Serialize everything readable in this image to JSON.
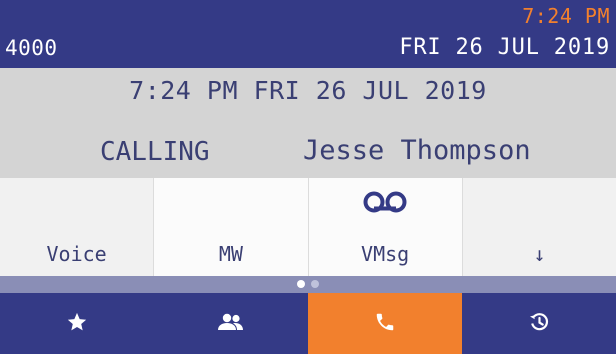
{
  "status_bar": {
    "extension": "4000",
    "time": "7:24 PM",
    "date": "FRI 26 JUL 2019"
  },
  "call_info": {
    "datetime": "7:24 PM FRI 26 JUL 2019",
    "status": "CALLING",
    "caller": "Jesse Thompson"
  },
  "softkeys": [
    {
      "label": "Voice"
    },
    {
      "label": "MW"
    },
    {
      "label": "VMsg",
      "icon": "voicemail-icon"
    },
    {
      "label": "↓"
    }
  ],
  "pager": {
    "pages": 2,
    "current": 1
  },
  "nav": [
    {
      "icon": "star-icon",
      "name": "favorites"
    },
    {
      "icon": "contacts-icon",
      "name": "contacts"
    },
    {
      "icon": "phone-icon",
      "name": "calls",
      "active": true
    },
    {
      "icon": "history-icon",
      "name": "history"
    }
  ],
  "colors": {
    "bar": "#343a86",
    "accent": "#f2802d",
    "info_bg": "#d4d4d4",
    "text": "#3a3f73"
  }
}
